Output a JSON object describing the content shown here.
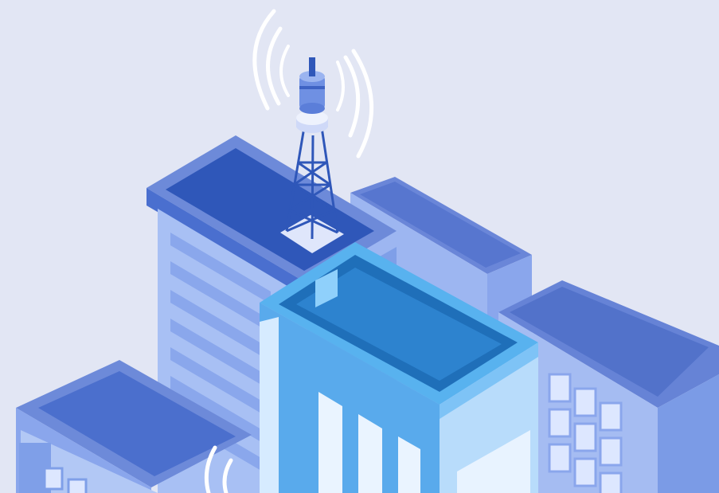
{
  "colors": {
    "background": "#e2e6f4",
    "roof_dark": "#2f57b9",
    "roof_mid": "#4f74d6",
    "wall_light": "#a9c1f3",
    "wall_mid": "#7f9fe8",
    "wall_dark": "#5f82da",
    "cyan_building": "#4aa5e8",
    "cyan_building_dark": "#1f6fb9",
    "signal_wave": "#ffffff",
    "window_glass": "#dde7ff"
  },
  "scene": {
    "subject": "isometric-city-with-cell-tower",
    "icons": [
      "cell-tower-icon",
      "signal-wave-icon",
      "building-icon"
    ]
  }
}
